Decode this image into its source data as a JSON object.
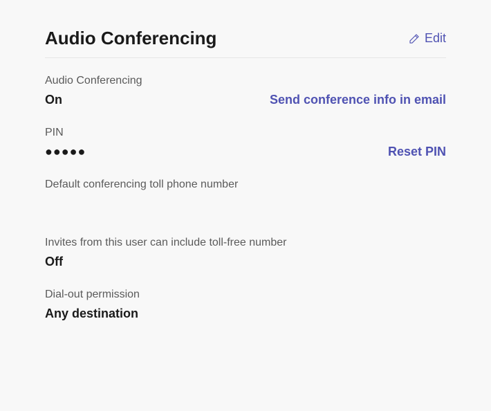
{
  "header": {
    "title": "Audio Conferencing",
    "edit_label": "Edit"
  },
  "fields": {
    "audio_conferencing": {
      "label": "Audio Conferencing",
      "value": "On",
      "action": "Send conference info in email"
    },
    "pin": {
      "label": "PIN",
      "value": "●●●●●",
      "action": "Reset PIN"
    },
    "toll_number": {
      "label": "Default conferencing toll phone number",
      "value": ""
    },
    "toll_free": {
      "label": "Invites from this user can include toll-free number",
      "value": "Off"
    },
    "dial_out": {
      "label": "Dial-out permission",
      "value": "Any destination"
    }
  }
}
